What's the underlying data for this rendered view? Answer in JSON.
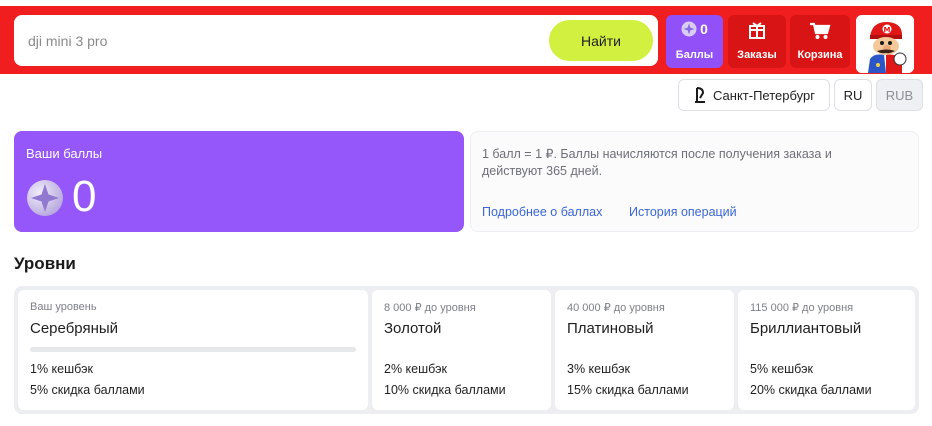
{
  "header": {
    "search": {
      "value": "",
      "placeholder": "dji mini 3 pro",
      "button_label": "Найти"
    },
    "points_button": {
      "count": "0",
      "label": "Баллы",
      "icon": "coin-icon"
    },
    "orders_button": {
      "label": "Заказы",
      "icon": "box-icon"
    },
    "cart_button": {
      "label": "Корзина",
      "icon": "cart-icon"
    },
    "avatar": {
      "icon": "user-avatar"
    }
  },
  "settings": {
    "city": "Санкт-Петербург",
    "city_icon": "location-pin-icon",
    "language": "RU",
    "currency": "RUB"
  },
  "points_card": {
    "title": "Ваши баллы",
    "value": "0",
    "icon": "coin-icon"
  },
  "info_card": {
    "text": "1 балл = 1 ₽. Баллы начисляются после получения заказа и действуют 365 дней.",
    "link_more": "Подробнее о баллах",
    "link_history": "История операций"
  },
  "levels": {
    "title": "Уровни",
    "items": [
      {
        "sub": "Ваш уровень",
        "name": "Серебряный",
        "progress": 0,
        "perk_cashback": "1% кешбэк",
        "perk_discount": "5% скидка баллами"
      },
      {
        "sub": "8 000 ₽ до уровня",
        "name": "Золотой",
        "perk_cashback": "2% кешбэк",
        "perk_discount": "10% скидка баллами"
      },
      {
        "sub": "40 000 ₽ до уровня",
        "name": "Платиновый",
        "perk_cashback": "3% кешбэк",
        "perk_discount": "15% скидка баллами"
      },
      {
        "sub": "115 000 ₽ до уровня",
        "name": "Бриллиантовый",
        "perk_cashback": "5% кешбэк",
        "perk_discount": "20% скидка баллами"
      }
    ]
  },
  "colors": {
    "header_bg": "#f01e1e",
    "accent_purple": "#9556fa",
    "search_button": "#d2f040",
    "link": "#3b66d6"
  }
}
